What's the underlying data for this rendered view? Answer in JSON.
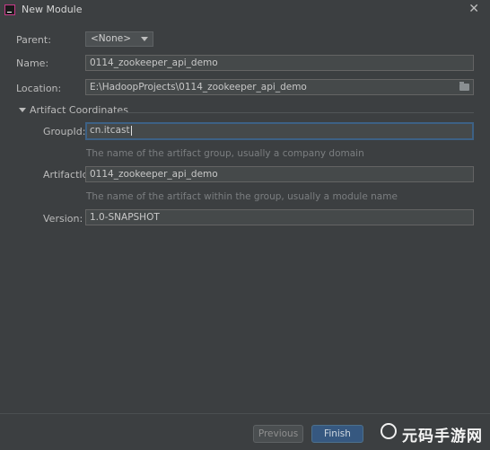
{
  "window": {
    "title": "New Module",
    "close_glyph": "✕",
    "icon": "intellij-idea-icon"
  },
  "form": {
    "parent": {
      "label": "Parent:",
      "value": "<None>"
    },
    "name": {
      "label": "Name:",
      "value": "0114_zookeeper_api_demo"
    },
    "location": {
      "label": "Location:",
      "value": "E:\\HadoopProjects\\0114_zookeeper_api_demo"
    }
  },
  "artifact": {
    "section_label": "Artifact Coordinates",
    "group_id": {
      "label": "GroupId:",
      "value": "cn.itcast",
      "hint": "The name of the artifact group, usually a company domain"
    },
    "artifact_id": {
      "label": "ArtifactId:",
      "value": "0114_zookeeper_api_demo",
      "hint": "The name of the artifact within the group, usually a module name"
    },
    "version": {
      "label": "Version:",
      "value": "1.0-SNAPSHOT"
    }
  },
  "buttons": {
    "previous": "Previous",
    "finish": "Finish"
  },
  "watermark": {
    "text": "元码手游网"
  },
  "colors": {
    "background": "#3c3f41",
    "focus_border": "#3d6185",
    "primary_button": "#365880"
  }
}
